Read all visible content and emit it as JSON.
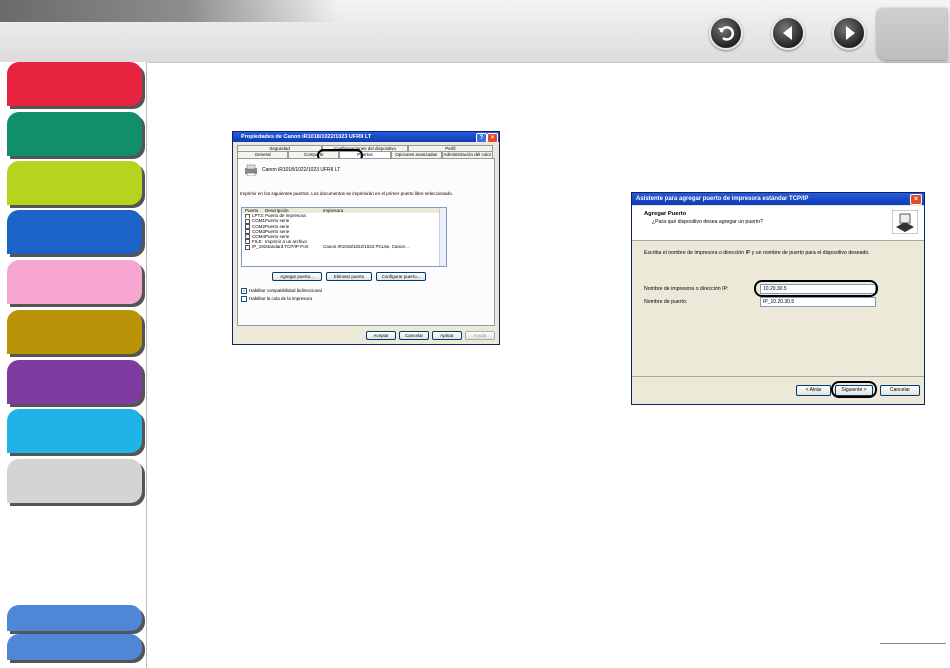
{
  "colors": {
    "nav_buttons": [
      "#e8233f",
      "#10906a",
      "#b5d41e",
      "#1b63c6",
      "#f7a6d2",
      "#bb9308",
      "#7f3ba0",
      "#1fb3e7",
      "#d4d4d4",
      "#4f86d6",
      "#4f86d6"
    ]
  },
  "nav": {
    "back_icon": "back-icon",
    "prev_icon": "previous-icon",
    "next_icon": "next-icon"
  },
  "dialog1": {
    "title": "Propiedades de Canon iR1018/1022/1023 UFRII LT",
    "tabs_row1": [
      "Seguridad",
      "Configuraciones del dispositivo",
      "Perfil"
    ],
    "tabs_row2": [
      "General",
      "Compartir",
      "Puertos",
      "Opciones avanzadas",
      "Administración del color"
    ],
    "printer_name": "Canon iR1018/1022/1023 UFRII LT",
    "instruction": "Imprimir en los siguientes puertos. Los documentos se imprimirán en el primer puerto libre seleccionado.",
    "columns": [
      "Puerto",
      "Descripción",
      "Impresora"
    ],
    "ports": [
      {
        "port": "LPT3:",
        "desc": "Puerto de impresora",
        "printer": ""
      },
      {
        "port": "COM1:",
        "desc": "Puerto serie",
        "printer": ""
      },
      {
        "port": "COM2:",
        "desc": "Puerto serie",
        "printer": ""
      },
      {
        "port": "COM3:",
        "desc": "Puerto serie",
        "printer": ""
      },
      {
        "port": "COM4:",
        "desc": "Puerto serie",
        "printer": ""
      },
      {
        "port": "FILE:",
        "desc": "Imprimir a un archivo",
        "printer": ""
      },
      {
        "port": "IP_1921...",
        "desc": "Standard TCP/IP Port",
        "printer": "Canon iR1018/1022/1023 PCL5e, Canon..."
      }
    ],
    "btn_add_port": "Agregar puerto...",
    "btn_delete_port": "Eliminar puerto",
    "btn_configure_port": "Configurar puerto...",
    "chk_bidirectional": "Habilitar compatibilidad bidireccional",
    "chk_pool": "Habilitar la cola de la impresora",
    "btn_ok": "Aceptar",
    "btn_cancel": "Cancelar",
    "btn_apply": "Aplicar",
    "btn_help": "Ayuda"
  },
  "dialog2": {
    "title": "Asistente para agregar puerto de impresora estándar TCP/IP",
    "heading": "Agregar Puerto",
    "subheading": "¿Para qué dispositivo desea agregar un puerto?",
    "instruction": "Escriba el nombre de impresora o dirección IP y un nombre de puerto para el dispositivo deseado.",
    "label_ip": "Nombre de impresora o dirección IP:",
    "value_ip": "10.20.30.5",
    "label_port": "Nombre de puerto:",
    "value_port": "IP_10.20.30.5",
    "btn_back": "< Atrás",
    "btn_next": "Siguiente >",
    "btn_cancel": "Cancelar"
  }
}
